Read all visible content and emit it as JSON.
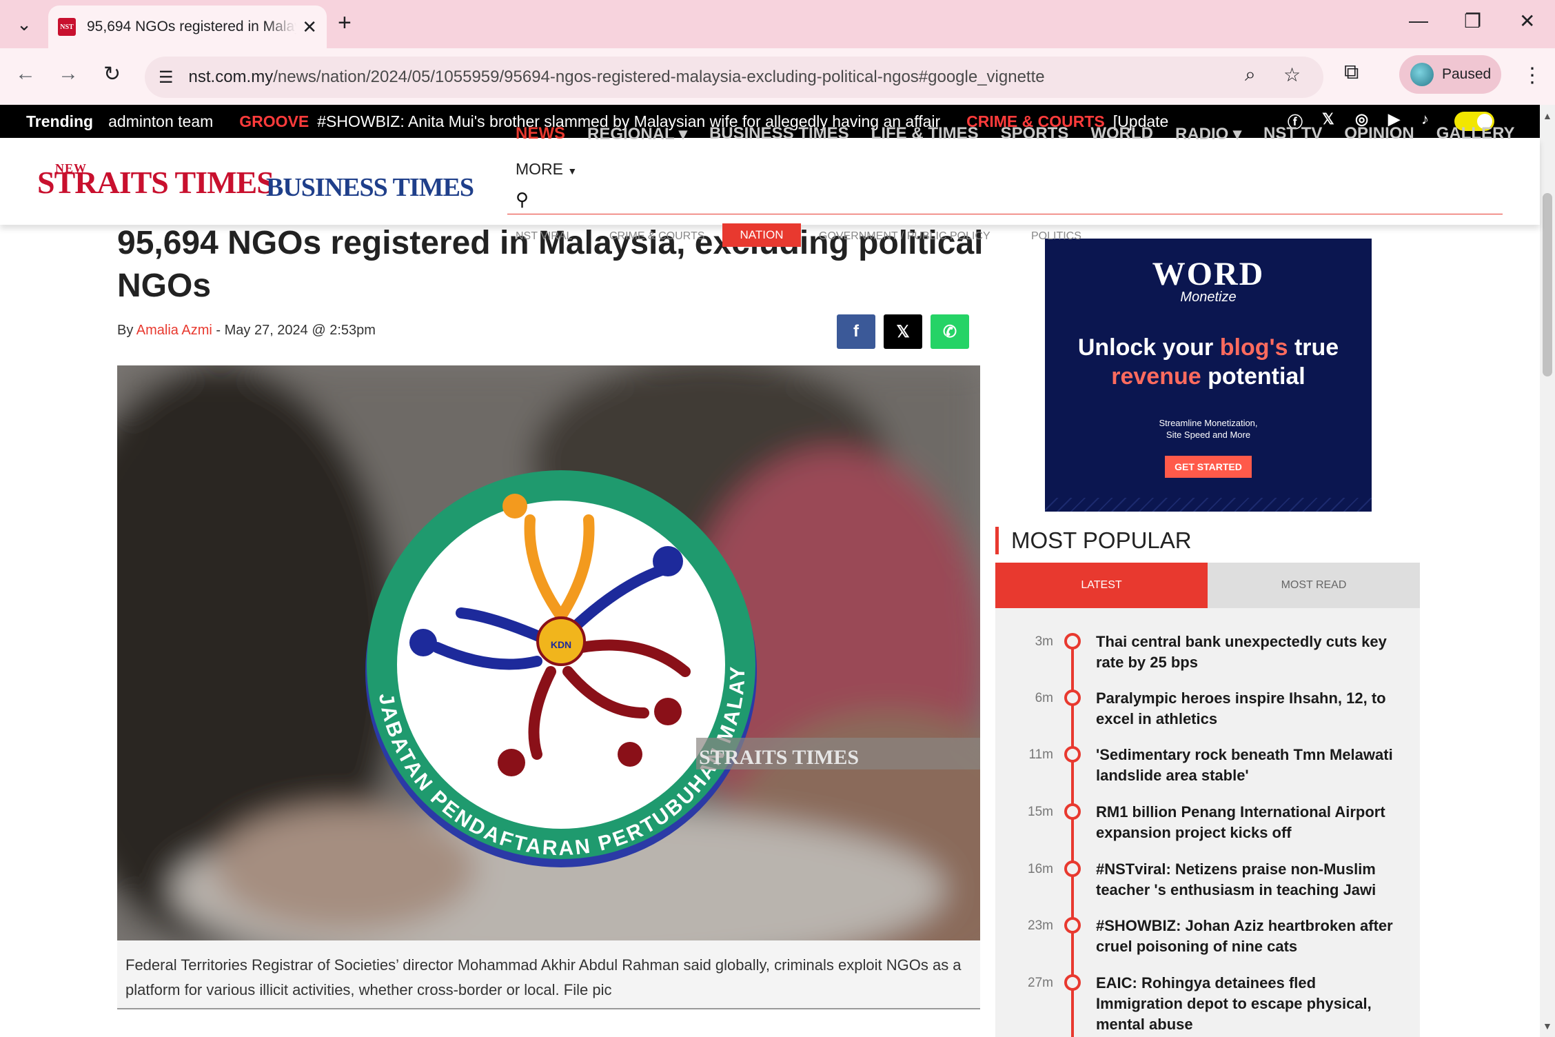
{
  "browser": {
    "tab_title": "95,694 NGOs registered in Malaysia, excluding political NGOs",
    "favicon_text": "NST",
    "url_host": "nst.com.my",
    "url_path": "/news/nation/2024/05/1055959/95694-ngos-registered-malaysia-excluding-political-ngos#google_vignette",
    "profile_label": "Paused",
    "icons": [
      "tab-search-icon",
      "close-icon",
      "plus-icon",
      "minimize-icon",
      "restore-icon",
      "back-icon",
      "forward-icon",
      "reload-icon",
      "site-info-icon",
      "zoom-icon",
      "star-icon",
      "extensions-icon",
      "kebab-icon"
    ]
  },
  "trending": {
    "label": "Trending",
    "items": [
      {
        "category": "",
        "text": "adminton team"
      },
      {
        "category": "GROOVE",
        "text": "#SHOWBIZ: Anita Mui's brother slammed by Malaysian wife for allegedly having an affair"
      },
      {
        "category": "CRIME & COURTS",
        "text": "[Update"
      }
    ],
    "social_icons": [
      "facebook-icon",
      "x-icon",
      "instagram-icon",
      "youtube-icon",
      "tiktok-icon"
    ]
  },
  "site": {
    "logo_nst_small": "NEW",
    "logo_nst_big": "STRAITS TIMES",
    "logo_bt": "BUSINESS TIMES",
    "main_nav": [
      "NEWS",
      "REGIONAL ▾",
      "BUSINESS TIMES",
      "LIFE & TIMES",
      "SPORTS",
      "WORLD",
      "RADIO ▾",
      "NST TV",
      "OPINION",
      "GALLERY"
    ],
    "more_label": "MORE",
    "sub_nav": [
      "NST VIRAL",
      "CRIME & COURTS",
      "NATION",
      "GOVERNMENT / PUBLIC POLICY",
      "POLITICS"
    ]
  },
  "article": {
    "headline": "95,694 NGOs registered in Malaysia, excluding political NGOs",
    "by": "By",
    "author": "Amalia Azmi",
    "date": " - May 27, 2024 @ 2:53pm",
    "share": [
      "facebook-share",
      "x-share",
      "whatsapp-share"
    ],
    "image_logo_text": "JABATAN PENDAFTARAN PERTUBUHAN MALAYSIA",
    "image_badge": "KDN",
    "image_watermark": "STRAITS TIMES",
    "caption": "Federal Territories Registrar of Societies’ director Mohammad Akhir Abdul Rahman said globally, criminals exploit NGOs as a platform for various illicit activities, whether cross-border or local. File pic"
  },
  "ad": {
    "brand": "WORD",
    "brand_sub": "Monetize",
    "headline_1": "Unlock your ",
    "headline_hl": "blog's",
    "headline_2": " true",
    "headline_3a": "revenue",
    "headline_3b": " potential",
    "sub_1": "Streamline Monetization,",
    "sub_2": "Site Speed and More",
    "cta": "GET STARTED"
  },
  "most_popular": {
    "title": "MOST POPULAR",
    "tabs": [
      "LATEST",
      "MOST READ"
    ],
    "items": [
      {
        "time": "3m",
        "text": "Thai central bank unexpectedly cuts key rate by 25 bps"
      },
      {
        "time": "6m",
        "text": "Paralympic heroes inspire Ihsahn, 12, to excel in athletics"
      },
      {
        "time": "11m",
        "text": "'Sedimentary rock beneath Tmn Melawati landslide area stable'"
      },
      {
        "time": "15m",
        "text": "RM1 billion Penang International Airport expansion project kicks off"
      },
      {
        "time": "16m",
        "text": "#NSTviral: Netizens praise non-Muslim teacher 's enthusiasm in teaching Jawi"
      },
      {
        "time": "23m",
        "text": "#SHOWBIZ: Johan Aziz heartbroken after cruel poisoning of nine cats"
      },
      {
        "time": "27m",
        "text": "EAIC: Rohingya detainees fled Immigration depot to escape physical, mental abuse"
      }
    ]
  },
  "colors": {
    "accent": "#e8392f",
    "tab_bar": "#f7d3dd",
    "bt_blue": "#1f3f8a"
  }
}
